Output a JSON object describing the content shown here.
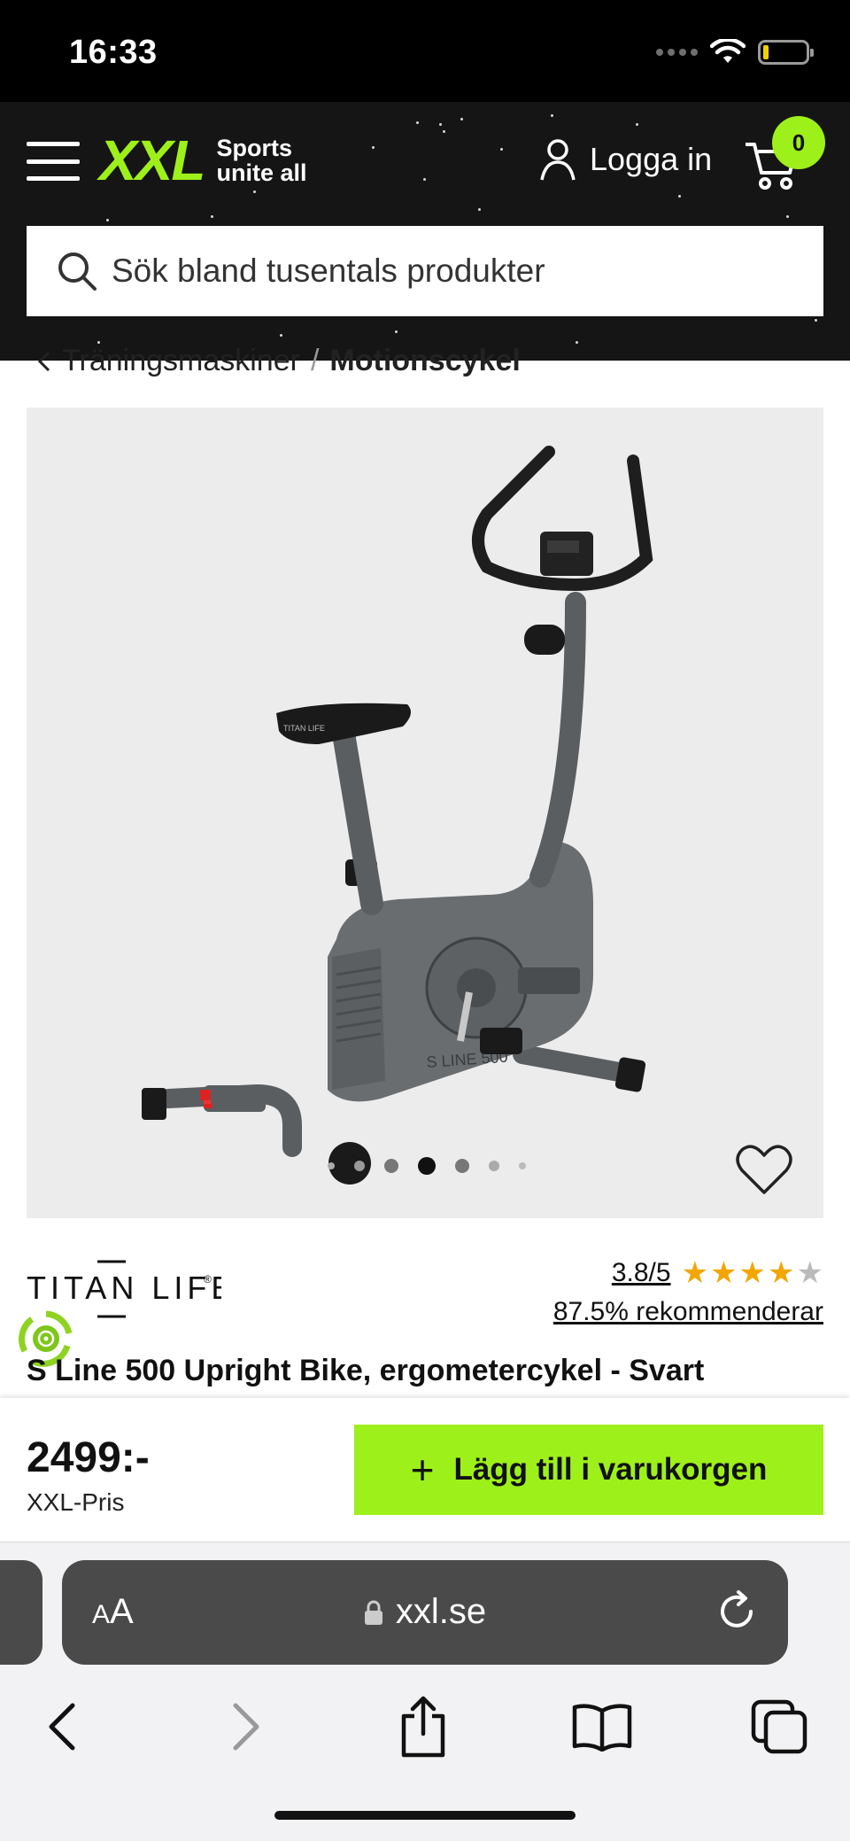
{
  "status_bar": {
    "time": "16:33"
  },
  "header": {
    "logo_text": "XXL",
    "logo_tagline_1": "Sports",
    "logo_tagline_2": "unite all",
    "login_label": "Logga in",
    "cart_count": "0",
    "search_placeholder": "Sök bland tusentals produkter",
    "brand_color": "#9ef01a"
  },
  "breadcrumb": {
    "parent": "Träningsmaskiner",
    "separator": "/",
    "current": "Motionscykel"
  },
  "product": {
    "image_icon": "exercise-bike-icon",
    "image_model_label": "S LINE 500",
    "saddle_brand": "TITAN LIFE",
    "carousel": {
      "total": 7,
      "active_index": 3
    },
    "brand": "TITAN LIFE",
    "rating_score": "3.8/5",
    "rating_value": 3.8,
    "rating_max": 5,
    "recommend_text": "87.5% rekommenderar",
    "title": "S Line 500 Upright Bike, ergometercykel - Svart"
  },
  "purchase": {
    "price": "2499:-",
    "price_label": "XXL-Pris",
    "add_to_cart_label": "Lägg till i varukorgen"
  },
  "browser": {
    "aa_small": "A",
    "aa_large": "A",
    "url": "xxl.se"
  }
}
